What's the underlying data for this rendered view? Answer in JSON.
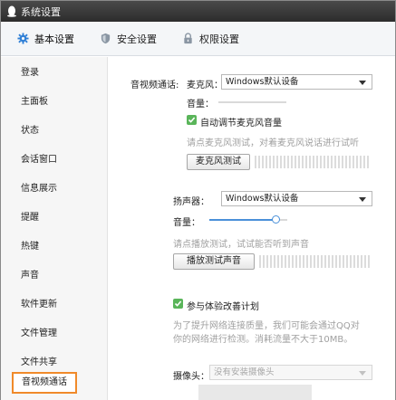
{
  "window": {
    "title": "系统设置"
  },
  "tabs": [
    {
      "label": "基本设置"
    },
    {
      "label": "安全设置"
    },
    {
      "label": "权限设置"
    }
  ],
  "sidebar": {
    "items": [
      {
        "label": "登录"
      },
      {
        "label": "主面板"
      },
      {
        "label": "状态"
      },
      {
        "label": "会话窗口"
      },
      {
        "label": "信息展示"
      },
      {
        "label": "提醒"
      },
      {
        "label": "热键"
      },
      {
        "label": "声音"
      },
      {
        "label": "软件更新"
      },
      {
        "label": "文件管理"
      },
      {
        "label": "文件共享"
      },
      {
        "label": "音视频通话"
      }
    ],
    "selected": "音视频通话"
  },
  "av": {
    "section_label": "音视频通话:",
    "mic": {
      "label": "麦克风：",
      "device": "Windows默认设备",
      "volume_label": "音量：",
      "auto_adjust_label": "自动调节麦克风音量",
      "auto_adjust_checked": true,
      "hint": "请点麦克风测试，对着麦克风说话进行试听",
      "test_button": "麦克风测试"
    },
    "speaker": {
      "label": "扬声器：",
      "device": "Windows默认设备",
      "volume_label": "音量：",
      "volume_level": 0.85,
      "hint": "请点播放测试，试试能否听到声音",
      "test_button": "播放测试声音"
    },
    "experience": {
      "label": "参与体验改善计划",
      "checked": true,
      "description_line1": "为了提升网络连接质量，我们可能会通过QQ对",
      "description_line2": "你的网络进行检测。消耗流量不大于10MB。"
    },
    "camera": {
      "label": "摄像头：",
      "device": "没有安装摄像头"
    }
  },
  "colors": {
    "titlebar": "#2c2c2c",
    "accent_orange": "#f08a2a",
    "checkbox_green": "#5ab55a",
    "slider_blue": "#4a90d9",
    "tab_icon_blue": "#2f7fd6"
  },
  "icons": {
    "title": "qq-penguin-icon",
    "basic": "gear-icon",
    "security": "shield-icon",
    "permission": "lock-icon"
  }
}
